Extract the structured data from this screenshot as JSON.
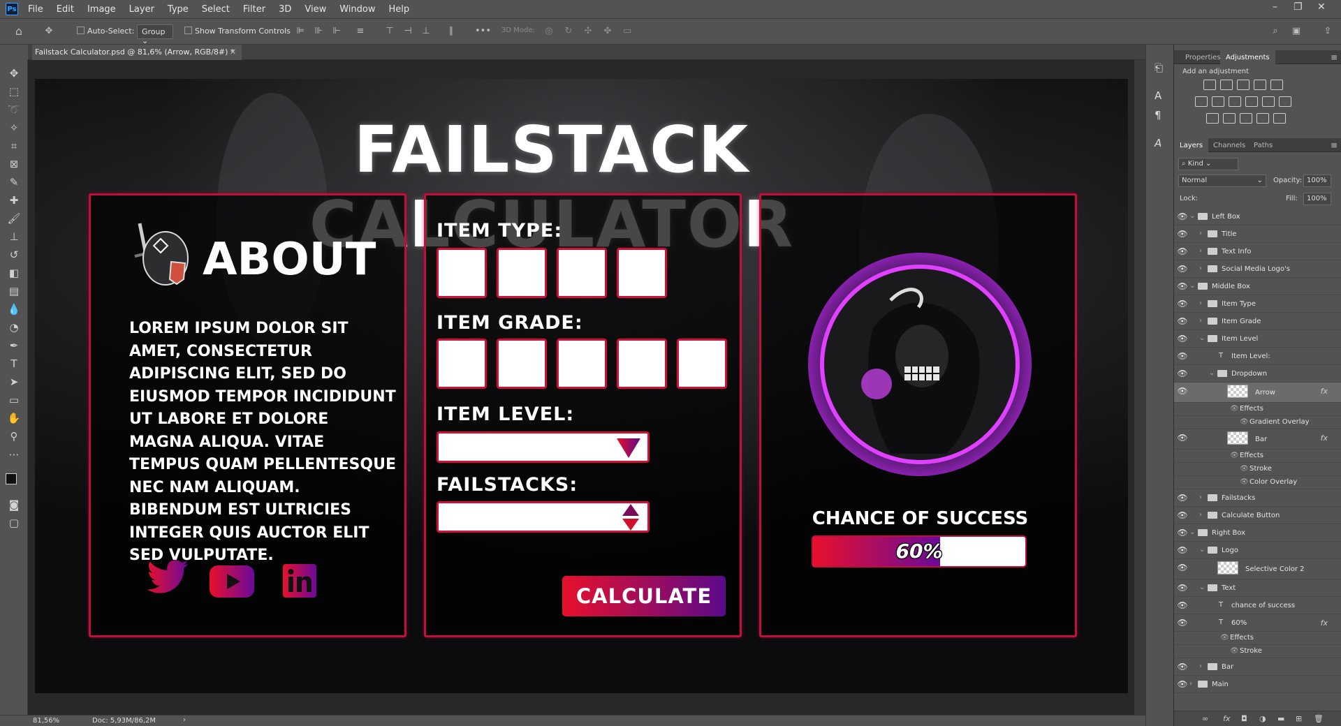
{
  "menu": {
    "items": [
      "File",
      "Edit",
      "Image",
      "Layer",
      "Type",
      "Select",
      "Filter",
      "3D",
      "View",
      "Window",
      "Help"
    ]
  },
  "options": {
    "auto_select": "Auto-Select:",
    "group": "Group",
    "transform": "Show Transform Controls",
    "mode_3d": "3D Mode:"
  },
  "doc": {
    "tab_title": "Failstack Calculator.psd @ 81,6% (Arrow, RGB/8#) *",
    "zoom": "81,56%",
    "doc_size": "Doc: 5,93M/86,2M"
  },
  "artwork": {
    "title": "FAILSTACK CALCULATOR",
    "about_title": "ABOUT",
    "about_text": "Lorem ipsum dolor sit amet, consectetur adipiscing elit, sed do eiusmod tempor incididunt ut labore et dolore magna aliqua. Vitae tempus quam pellentesque nec nam aliquam. Bibendum est ultricies integer quis auctor elit sed vulputate.",
    "item_type": "ITEM TYPE:",
    "item_grade": "ITEM GRADE:",
    "item_level": "ITEM LEVEL:",
    "failstacks": "FAILSTACKS:",
    "calculate": "CALCULATE",
    "chance_label": "CHANCE OF SUCCESS",
    "chance_value": "60%",
    "chance_fraction": 0.6,
    "item_type_slots": 4,
    "item_grade_slots": 5
  },
  "panels": {
    "properties_tab": "Properties",
    "adjustments_tab": "Adjustments",
    "add_adjustment": "Add an adjustment",
    "layers_tab": "Layers",
    "channels_tab": "Channels",
    "paths_tab": "Paths",
    "kind": "Kind",
    "blend": "Normal",
    "opacity_label": "Opacity:",
    "opacity_value": "100%",
    "lock_label": "Lock:",
    "fill_label": "Fill:",
    "fill_value": "100%"
  },
  "layers": [
    {
      "name": "Left Box",
      "type": "folder",
      "indent": 0,
      "open": true
    },
    {
      "name": "Title",
      "type": "folder",
      "indent": 1,
      "open": false
    },
    {
      "name": "Text Info",
      "type": "folder",
      "indent": 1,
      "open": false
    },
    {
      "name": "Social Media Logo's",
      "type": "folder",
      "indent": 1,
      "open": false
    },
    {
      "name": "Middle Box",
      "type": "folder",
      "indent": 0,
      "open": true
    },
    {
      "name": "Item Type",
      "type": "folder",
      "indent": 1,
      "open": false
    },
    {
      "name": "Item Grade",
      "type": "folder",
      "indent": 1,
      "open": false
    },
    {
      "name": "Item Level",
      "type": "folder",
      "indent": 1,
      "open": true
    },
    {
      "name": "Item Level:",
      "type": "text",
      "indent": 2
    },
    {
      "name": "Dropdown",
      "type": "folder",
      "indent": 2,
      "open": true
    },
    {
      "name": "Arrow",
      "type": "pixel",
      "indent": 3,
      "fx": true,
      "selected": true
    },
    {
      "name": "Effects",
      "type": "effect",
      "indent": 4
    },
    {
      "name": "Gradient Overlay",
      "type": "effect",
      "indent": 5
    },
    {
      "name": "Bar",
      "type": "pixel",
      "indent": 3,
      "fx": true
    },
    {
      "name": "Effects",
      "type": "effect",
      "indent": 4
    },
    {
      "name": "Stroke",
      "type": "effect",
      "indent": 5
    },
    {
      "name": "Color Overlay",
      "type": "effect",
      "indent": 5
    },
    {
      "name": "Failstacks",
      "type": "folder",
      "indent": 1,
      "open": false
    },
    {
      "name": "Calculate Button",
      "type": "folder",
      "indent": 1,
      "open": false
    },
    {
      "name": "Right Box",
      "type": "folder",
      "indent": 0,
      "open": true
    },
    {
      "name": "Logo",
      "type": "folder",
      "indent": 1,
      "open": true
    },
    {
      "name": "Selective Color 2",
      "type": "pixel",
      "indent": 2
    },
    {
      "name": "Text",
      "type": "folder",
      "indent": 1,
      "open": true
    },
    {
      "name": "chance of success",
      "type": "text",
      "indent": 2
    },
    {
      "name": "60%",
      "type": "text",
      "indent": 2,
      "fx": true
    },
    {
      "name": "Effects",
      "type": "effect",
      "indent": 3
    },
    {
      "name": "Stroke",
      "type": "effect",
      "indent": 4
    },
    {
      "name": "Bar",
      "type": "folder",
      "indent": 1,
      "open": false
    },
    {
      "name": "Main",
      "type": "folder",
      "indent": 0,
      "open": false
    }
  ],
  "colors": {
    "accent_red": "#e8102c",
    "accent_purple": "#6a0a9a",
    "ps_bg": "#535353"
  }
}
